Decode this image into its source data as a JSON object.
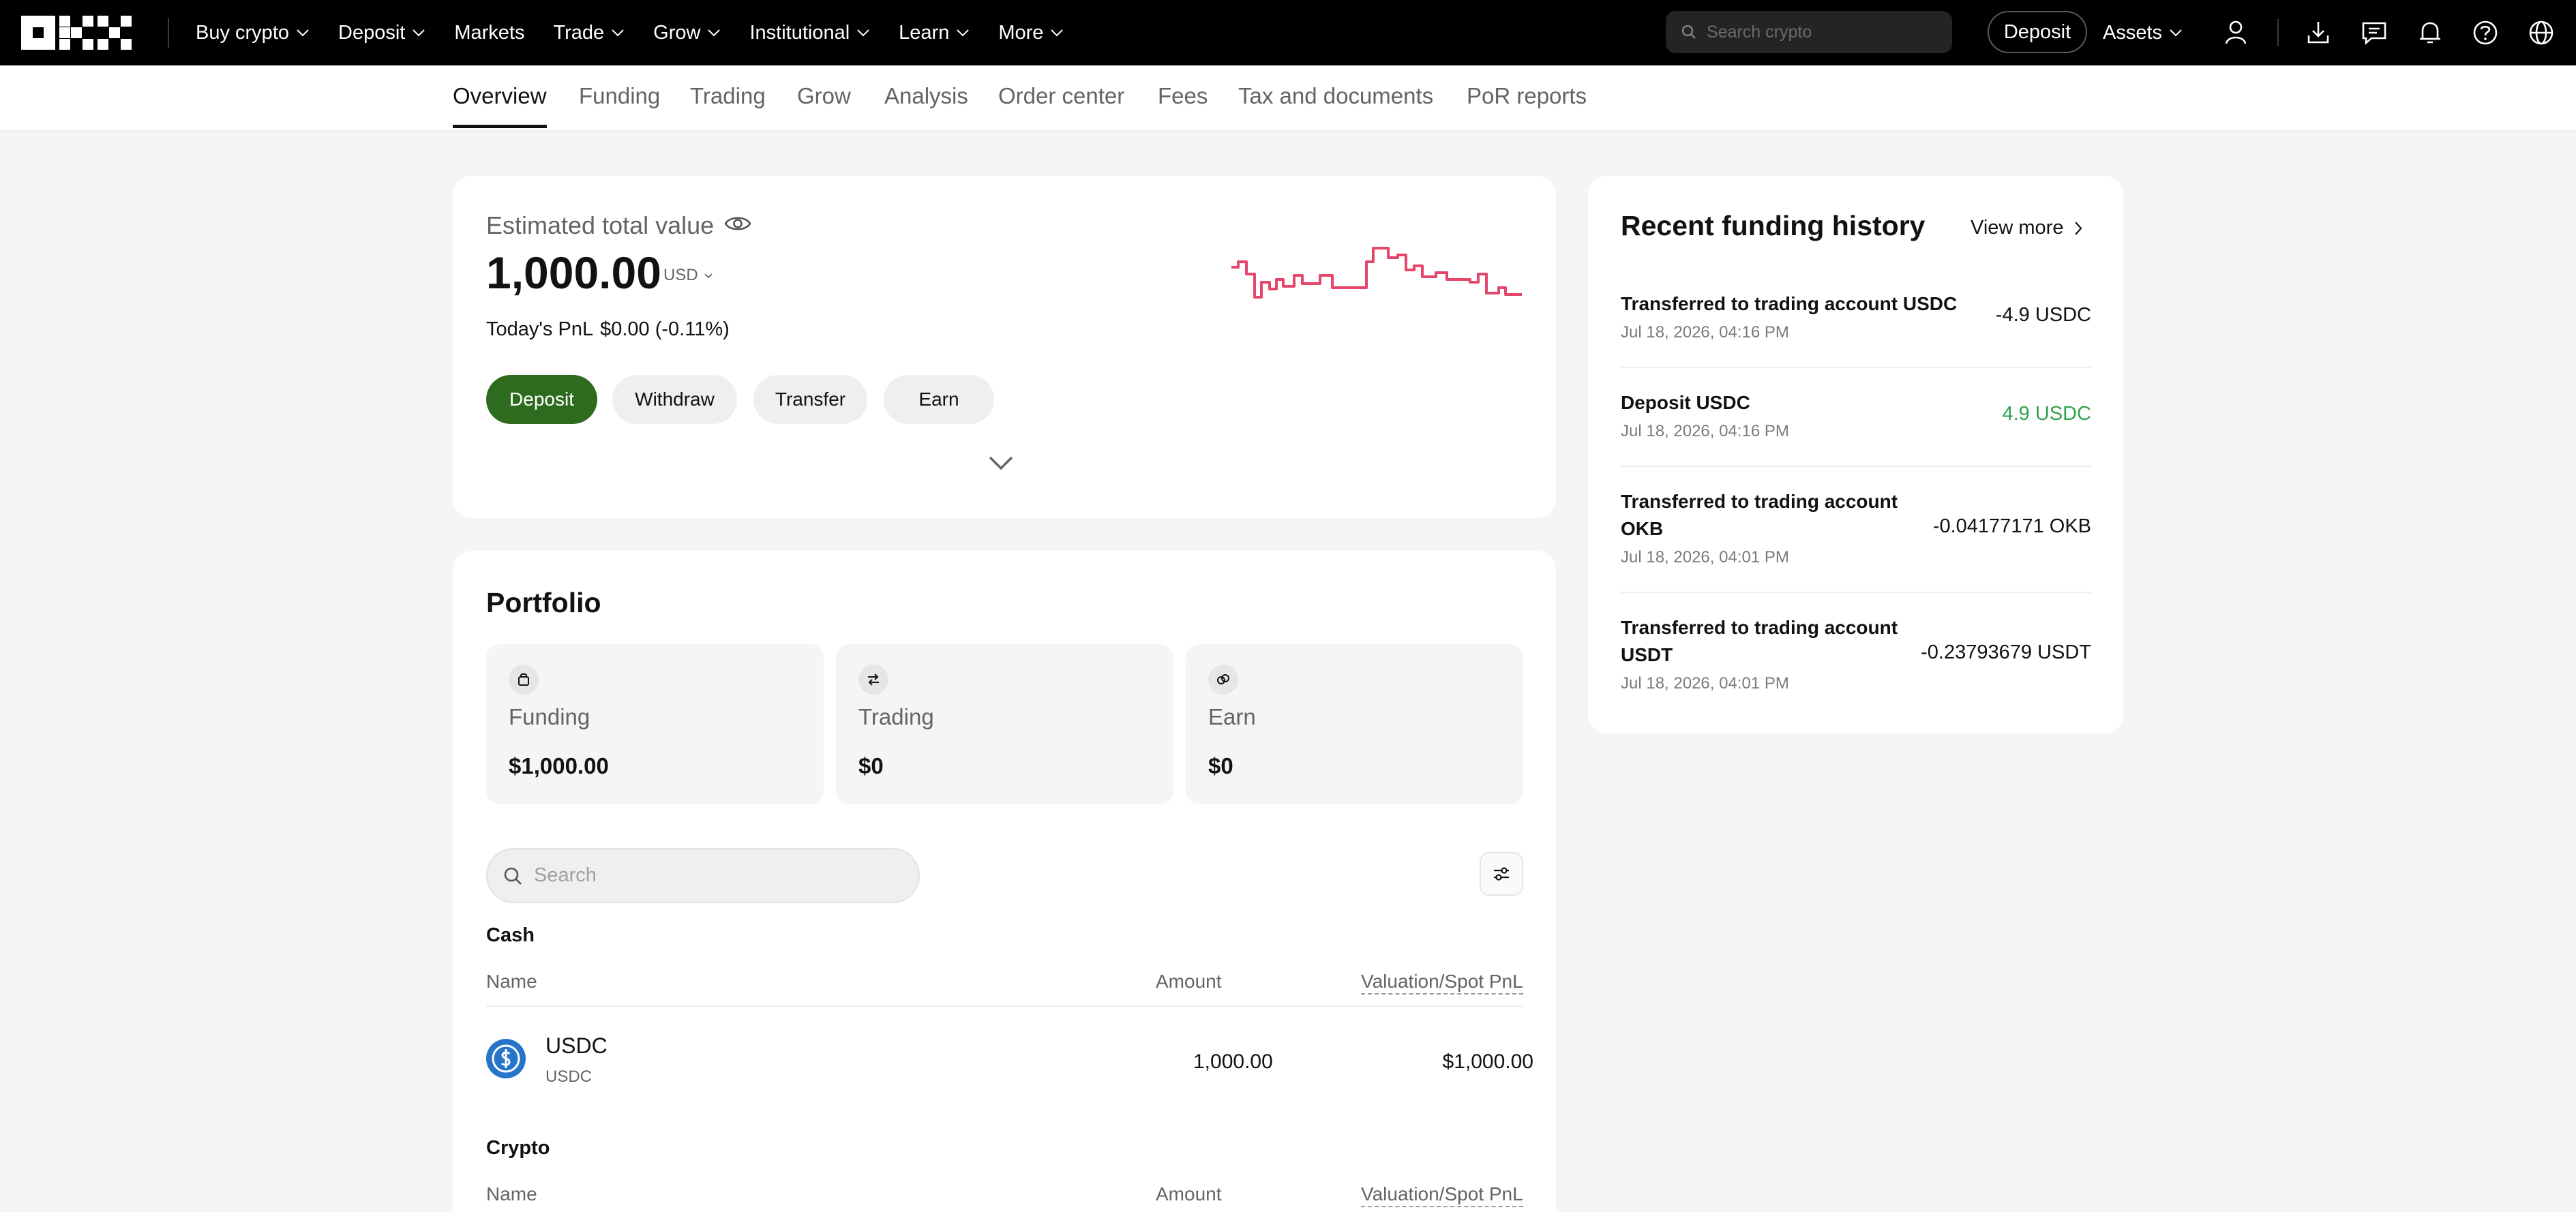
{
  "topnav": {
    "brand": "OKX",
    "items": [
      {
        "label": "Buy crypto",
        "has_dropdown": true
      },
      {
        "label": "Deposit",
        "has_dropdown": true
      },
      {
        "label": "Markets",
        "has_dropdown": false
      },
      {
        "label": "Trade",
        "has_dropdown": true
      },
      {
        "label": "Grow",
        "has_dropdown": true
      },
      {
        "label": "Institutional",
        "has_dropdown": true
      },
      {
        "label": "Learn",
        "has_dropdown": true
      },
      {
        "label": "More",
        "has_dropdown": true
      }
    ],
    "search_placeholder": "Search crypto",
    "deposit_label": "Deposit",
    "assets_label": "Assets",
    "icons": [
      "user-icon",
      "download-icon",
      "chat-icon",
      "bell-icon",
      "help-icon",
      "globe-icon"
    ]
  },
  "subnav": {
    "tabs": [
      "Overview",
      "Funding",
      "Trading",
      "Grow",
      "Analysis",
      "Order center",
      "Fees",
      "Tax and documents",
      "PoR reports"
    ],
    "active": "Overview"
  },
  "overview": {
    "label": "Estimated total value",
    "value": "1,000.00",
    "currency": "USD",
    "pnl_label": "Today's PnL",
    "pnl_value": "$0.00 (-0.11%)",
    "sparkline_color": "#e5466a",
    "actions": {
      "deposit": "Deposit",
      "withdraw": "Withdraw",
      "transfer": "Transfer",
      "earn": "Earn"
    },
    "primary_color": "#2e6b1e"
  },
  "portfolio": {
    "title": "Portfolio",
    "accounts": [
      {
        "label": "Funding",
        "value": "$1,000.00",
        "icon": "bag-icon"
      },
      {
        "label": "Trading",
        "value": "$0",
        "icon": "swap-icon"
      },
      {
        "label": "Earn",
        "value": "$0",
        "icon": "coins-icon"
      }
    ],
    "search_placeholder": "Search",
    "cash": {
      "title": "Cash",
      "headers": {
        "name": "Name",
        "amount": "Amount",
        "valuation": "Valuation/Spot PnL"
      },
      "rows": [
        {
          "name": "USDC",
          "sub": "USDC",
          "amount": "1,000.00",
          "value": "$1,000.00"
        }
      ]
    },
    "crypto": {
      "title": "Crypto",
      "headers": {
        "name": "Name",
        "amount": "Amount",
        "valuation": "Valuation/Spot PnL"
      }
    }
  },
  "history": {
    "title": "Recent funding history",
    "view_more": "View more",
    "items": [
      {
        "title": "Transferred to trading account USDC",
        "date": "Jul 18, 2026, 04:16 PM",
        "amount": "-4.9 USDC",
        "positive": false
      },
      {
        "title": "Deposit USDC",
        "date": "Jul 18, 2026, 04:16 PM",
        "amount": "4.9 USDC",
        "positive": true
      },
      {
        "title": "Transferred to trading account OKB",
        "date": "Jul 18, 2026, 04:01 PM",
        "amount": "-0.04177171 OKB",
        "positive": false
      },
      {
        "title": "Transferred to trading account USDT",
        "date": "Jul 18, 2026, 04:01 PM",
        "amount": "-0.23793679 USDT",
        "positive": false
      }
    ],
    "positive_color": "#31a24c"
  }
}
